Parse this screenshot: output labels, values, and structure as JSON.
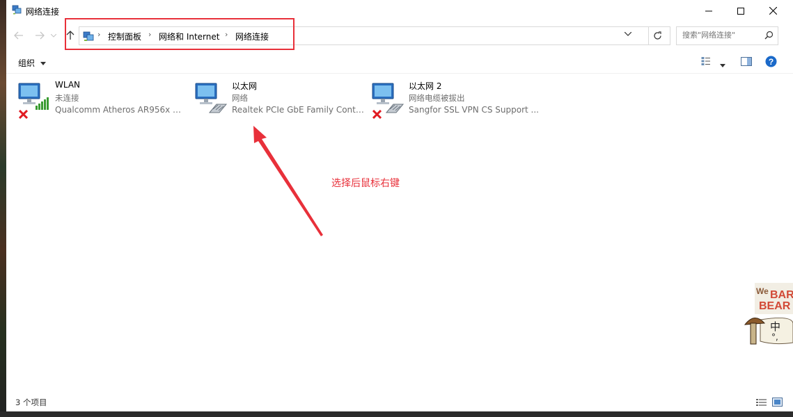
{
  "window": {
    "title": "网络连接",
    "controls": [
      "minimize",
      "maximize",
      "close"
    ]
  },
  "address": {
    "breadcrumbs": [
      "控制面板",
      "网络和 Internet",
      "网络连接"
    ]
  },
  "search": {
    "placeholder": "搜索\"网络连接\""
  },
  "toolbar": {
    "organize_label": "组织"
  },
  "connections": [
    {
      "name": "WLAN",
      "status": "未连接",
      "adapter": "Qualcomm Atheros AR956x Wi...",
      "icon": "wifi-adapter-icon",
      "error": true
    },
    {
      "name": "以太网",
      "status": "网络",
      "adapter": "Realtek PCIe GbE Family Contr...",
      "icon": "ethernet-adapter-icon",
      "error": false
    },
    {
      "name": "以太网 2",
      "status": "网络电缆被拔出",
      "adapter": "Sangfor SSL VPN CS Support ...",
      "icon": "ethernet-adapter-icon",
      "error": true
    }
  ],
  "annotation": {
    "text": "选择后鼠标右键",
    "color": "#e8303a"
  },
  "statusbar": {
    "item_count": "3 个项目"
  },
  "colors": {
    "accent": "#0078d7",
    "annotation_red": "#e8303a"
  }
}
